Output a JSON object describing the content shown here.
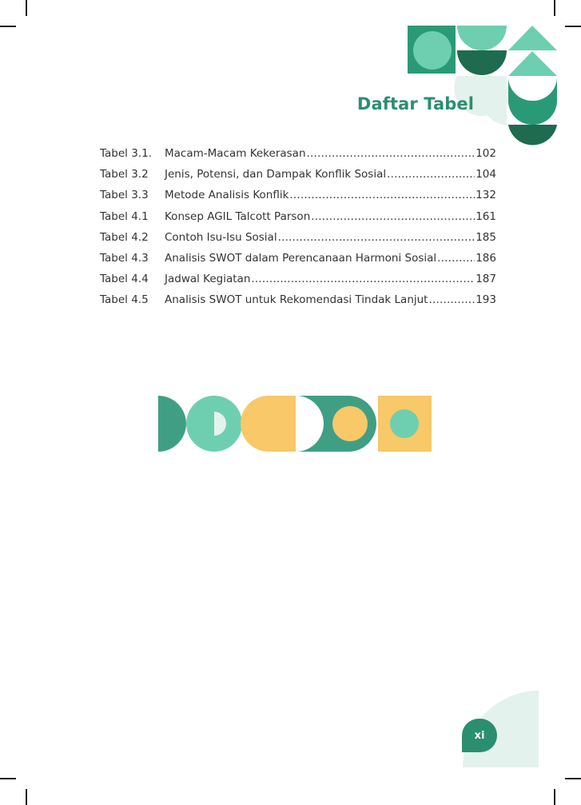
{
  "heading": "Daftar Tabel",
  "tables": [
    {
      "number": "Tabel 3.1.",
      "title": "Macam-Macam Kekerasan",
      "page": "102"
    },
    {
      "number": "Tabel 3.2",
      "title": "Jenis, Potensi, dan Dampak Konflik Sosial",
      "page": "104"
    },
    {
      "number": "Tabel 3.3",
      "title": "Metode Analisis Konflik",
      "page": "132"
    },
    {
      "number": "Tabel 4.1",
      "title": "Konsep AGIL Talcott Parson",
      "page": "161"
    },
    {
      "number": "Tabel 4.2",
      "title": "Contoh Isu-Isu Sosial",
      "page": "185"
    },
    {
      "number": "Tabel 4.3",
      "title": "Analisis SWOT dalam Perencanaan Harmoni Sosial",
      "page": "186"
    },
    {
      "number": "Tabel 4.4",
      "title": "Jadwal Kegiatan",
      "page": "187"
    },
    {
      "number": "Tabel 4.5",
      "title": "Analisis SWOT untuk Rekomendasi Tindak Lanjut",
      "page": "193"
    }
  ],
  "page_number": "xi",
  "colors": {
    "dark_green": "#1e6b50",
    "green": "#2a9a76",
    "teal": "#3f9f84",
    "mint": "#6ecfb0",
    "pale_mint": "#e3f2ec",
    "yellow": "#f8c869"
  }
}
